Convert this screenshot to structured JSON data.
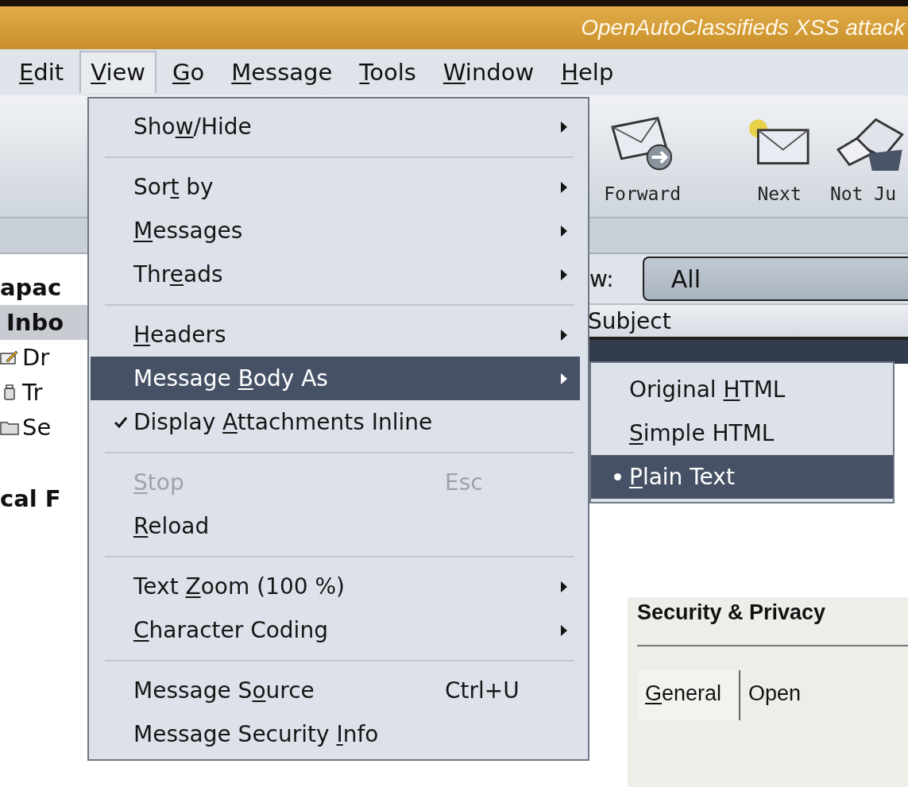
{
  "window": {
    "title": "OpenAutoClassifieds XSS attack"
  },
  "menubar": [
    {
      "label": {
        "key": "E",
        "post": "dit"
      },
      "selected": false
    },
    {
      "label": {
        "key": "V",
        "post": "iew"
      },
      "selected": true
    },
    {
      "label": {
        "key": "G",
        "post": "o"
      },
      "selected": false
    },
    {
      "label": {
        "key": "M",
        "post": "essage"
      },
      "selected": false
    },
    {
      "label": {
        "key": "T",
        "post": "ools"
      },
      "selected": false
    },
    {
      "label": {
        "key": "W",
        "post": "indow"
      },
      "selected": false
    },
    {
      "label": {
        "key": "H",
        "post": "elp"
      },
      "selected": false
    }
  ],
  "toolbar": [
    {
      "kind": "forward",
      "label": "Forward"
    },
    {
      "kind": "next",
      "label": "Next"
    },
    {
      "kind": "junk",
      "label": "Not Ju"
    }
  ],
  "filter": {
    "label": "w:",
    "value": "All"
  },
  "message_list": {
    "columns": [
      "Subject"
    ]
  },
  "folders": [
    {
      "kind": "account",
      "name": "apac",
      "selected": false
    },
    {
      "kind": "inbox",
      "name": "Inbo",
      "selected": true
    },
    {
      "kind": "drafts",
      "name": "Dr",
      "selected": false
    },
    {
      "kind": "trash",
      "name": "Tr",
      "selected": false
    },
    {
      "kind": "sent",
      "name": "Se",
      "selected": false
    },
    {
      "kind": "account",
      "name": "cal F",
      "selected": false
    }
  ],
  "view_menu": {
    "items": [
      {
        "kind": "submenu",
        "label": {
          "pre": "Sho",
          "key": "w",
          "post": "/Hide"
        },
        "selected": false,
        "disabled": false
      },
      {
        "kind": "separator"
      },
      {
        "kind": "submenu",
        "label": {
          "pre": "Sor",
          "key": "t",
          "post": " by"
        },
        "selected": false,
        "disabled": false
      },
      {
        "kind": "submenu",
        "label": {
          "key": "M",
          "post": "essages"
        },
        "selected": false,
        "disabled": false
      },
      {
        "kind": "submenu",
        "label": {
          "pre": "Thr",
          "key": "e",
          "post": "ads"
        },
        "selected": false,
        "disabled": false
      },
      {
        "kind": "separator"
      },
      {
        "kind": "submenu",
        "label": {
          "key": "H",
          "post": "eaders"
        },
        "selected": false,
        "disabled": false
      },
      {
        "kind": "submenu",
        "label": {
          "pre": "Message ",
          "key": "B",
          "post": "ody As"
        },
        "selected": true,
        "disabled": false
      },
      {
        "kind": "check",
        "label": {
          "pre": "Display ",
          "key": "A",
          "post": "ttachments Inline"
        },
        "checked": true,
        "selected": false,
        "disabled": false
      },
      {
        "kind": "separator"
      },
      {
        "kind": "command",
        "label": {
          "key": "S",
          "post": "top"
        },
        "shortcut": "Esc",
        "selected": false,
        "disabled": true
      },
      {
        "kind": "command",
        "label": {
          "key": "R",
          "post": "eload"
        },
        "selected": false,
        "disabled": false
      },
      {
        "kind": "separator"
      },
      {
        "kind": "submenu",
        "label": {
          "pre": "Text ",
          "key": "Z",
          "post": "oom (100 %)"
        },
        "selected": false,
        "disabled": false
      },
      {
        "kind": "submenu",
        "label": {
          "key": "C",
          "post": "haracter Coding"
        },
        "selected": false,
        "disabled": false
      },
      {
        "kind": "separator"
      },
      {
        "kind": "command",
        "label": {
          "pre": "Message S",
          "key": "o",
          "post": "urce"
        },
        "shortcut": "Ctrl+U",
        "selected": false,
        "disabled": false
      },
      {
        "kind": "command",
        "label": {
          "pre": "Message Security ",
          "key": "I",
          "post": "nfo"
        },
        "selected": false,
        "disabled": false
      }
    ]
  },
  "body_submenu": {
    "items": [
      {
        "label": {
          "pre": "Original ",
          "key": "H",
          "post": "TML"
        },
        "checked": false,
        "selected": false
      },
      {
        "label": {
          "key": "S",
          "post": "imple HTML"
        },
        "checked": false,
        "selected": false
      },
      {
        "label": {
          "key": "P",
          "post": "lain Text"
        },
        "checked": true,
        "selected": true
      }
    ]
  },
  "dialog": {
    "title": "Security & Privacy",
    "tabs": [
      {
        "label": {
          "key": "G",
          "post": "eneral"
        },
        "selected": true
      },
      {
        "label": {
          "pre": "Open"
        },
        "selected": false
      }
    ]
  }
}
